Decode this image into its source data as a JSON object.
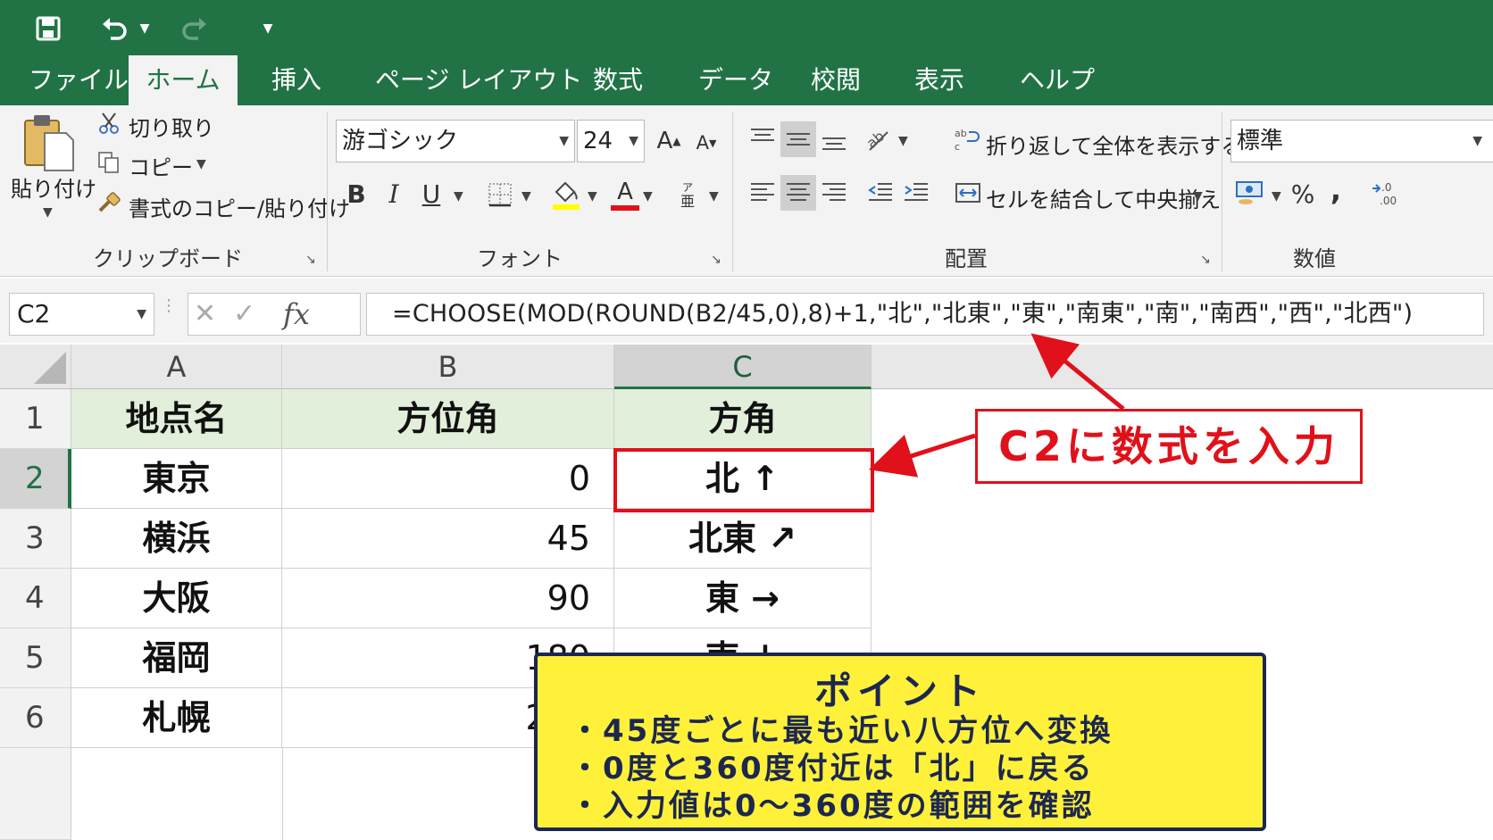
{
  "tabs": [
    "ファイル",
    "ホーム",
    "挿入",
    "ページ レイアウト",
    "数式",
    "データ",
    "校閲",
    "表示",
    "ヘルプ"
  ],
  "active_tab": "ホーム",
  "clipboard": {
    "paste": "貼り付け",
    "cut": "切り取り",
    "copy": "コピー",
    "format_painter": "書式のコピー/貼り付け",
    "group": "クリップボード"
  },
  "font": {
    "name": "游ゴシック",
    "size": "24",
    "bold": "B",
    "italic": "I",
    "underline": "U",
    "font_color_letter": "A",
    "group": "フォント"
  },
  "alignment": {
    "wrap": "折り返して全体を表示する",
    "merge": "セルを結合して中央揃え",
    "group": "配置"
  },
  "number": {
    "format": "標準",
    "percent": "%",
    "comma": ",",
    "group": "数値"
  },
  "formula_bar": {
    "name_box": "C2",
    "fx": "fx",
    "formula": "=CHOOSE(MOD(ROUND(B2/45,0),8)+1,\"北\",\"北東\",\"東\",\"南東\",\"南\",\"南西\",\"西\",\"北西\")"
  },
  "columns": [
    "A",
    "B",
    "C"
  ],
  "rows": [
    {
      "n": "1",
      "a": "地点名",
      "b": "方位角",
      "c": "方角"
    },
    {
      "n": "2",
      "a": "東京",
      "b": "0",
      "c": "北 ↑"
    },
    {
      "n": "3",
      "a": "横浜",
      "b": "45",
      "c": "北東 ↗"
    },
    {
      "n": "4",
      "a": "大阪",
      "b": "90",
      "c": "東 →"
    },
    {
      "n": "5",
      "a": "福岡",
      "b": "180",
      "c": "南 ↓"
    },
    {
      "n": "6",
      "a": "札幌",
      "b": "225",
      "c": ""
    }
  ],
  "callout": "C2に数式を入力",
  "point": {
    "title": "ポイント",
    "lines": [
      "・45度ごとに最も近い八方位へ変換",
      "・0度と360度付近は「北」に戻る",
      "・入力値は0～360度の範囲を確認"
    ]
  },
  "colors": {
    "excel_green": "#217346",
    "header_fill": "#e2efda",
    "highlight_red": "#e0111a",
    "note_yellow": "#fff13a",
    "note_navy": "#1c2750"
  }
}
